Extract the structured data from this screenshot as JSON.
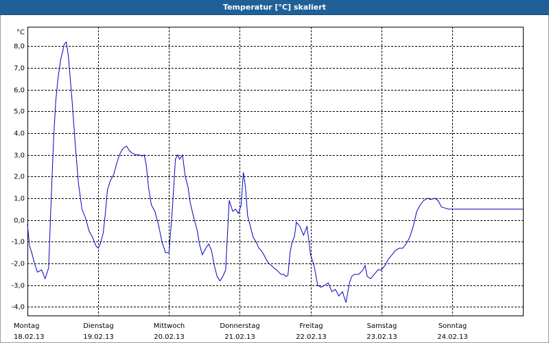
{
  "window": {
    "title": "Temperatur [°C] skaliert"
  },
  "colors": {
    "titlebar": "#1f6196",
    "line": "#0000c0",
    "grid": "#000000"
  },
  "chart_data": {
    "type": "line",
    "title": "Temperatur [°C] skaliert",
    "ylabel": "°C",
    "xlabel": "",
    "ylim": [
      -4.4,
      8.9
    ],
    "xlim": [
      0,
      7
    ],
    "grid": true,
    "yticks": [
      {
        "value": 8,
        "label": "8,0"
      },
      {
        "value": 7,
        "label": "7,0"
      },
      {
        "value": 6,
        "label": "6,0"
      },
      {
        "value": 5,
        "label": "5,0"
      },
      {
        "value": 4,
        "label": "4,0"
      },
      {
        "value": 3,
        "label": "3,0"
      },
      {
        "value": 2,
        "label": "2,0"
      },
      {
        "value": 1,
        "label": "1,0"
      },
      {
        "value": 0,
        "label": "0,0"
      },
      {
        "value": -1,
        "label": "-1,0"
      },
      {
        "value": -2,
        "label": "-2,0"
      },
      {
        "value": -3,
        "label": "-3,0"
      },
      {
        "value": -4,
        "label": "-4,0"
      }
    ],
    "xticks": [
      {
        "day": "Montag",
        "date": "18.02.13"
      },
      {
        "day": "Dienstag",
        "date": "19.02.13"
      },
      {
        "day": "Mittwoch",
        "date": "20.02.13"
      },
      {
        "day": "Donnerstag",
        "date": "21.02.13"
      },
      {
        "day": "Freitag",
        "date": "22.02.13"
      },
      {
        "day": "Samstag",
        "date": "23.02.13"
      },
      {
        "day": "Sonntag",
        "date": "24.02.13"
      }
    ],
    "series": [
      {
        "x": [
          0.0,
          0.03,
          0.06,
          0.1,
          0.14,
          0.2,
          0.25,
          0.3,
          0.33,
          0.37,
          0.4,
          0.43,
          0.47,
          0.5,
          0.52,
          0.55,
          0.58,
          0.63,
          0.68,
          0.72,
          0.77,
          0.82,
          0.87,
          0.92,
          0.97,
          1.0,
          1.03,
          1.07,
          1.1,
          1.13,
          1.17,
          1.22,
          1.26,
          1.3,
          1.33,
          1.37,
          1.4,
          1.44,
          1.47,
          1.5,
          1.53,
          1.58,
          1.62,
          1.65,
          1.68,
          1.71,
          1.75,
          1.8,
          1.85,
          1.9,
          1.95,
          2.0,
          2.05,
          2.09,
          2.12,
          2.15,
          2.19,
          2.23,
          2.27,
          2.3,
          2.35,
          2.4,
          2.43,
          2.47,
          2.52,
          2.56,
          2.6,
          2.64,
          2.68,
          2.72,
          2.76,
          2.8,
          2.85,
          2.9,
          2.94,
          2.98,
          3.02,
          3.05,
          3.08,
          3.11,
          3.15,
          3.19,
          3.23,
          3.27,
          3.3,
          3.34,
          3.37,
          3.41,
          3.45,
          3.48,
          3.52,
          3.55,
          3.58,
          3.62,
          3.65,
          3.68,
          3.71,
          3.74,
          3.77,
          3.8,
          3.85,
          3.9,
          3.95,
          4.0,
          4.05,
          4.1,
          4.15,
          4.2,
          4.25,
          4.3,
          4.35,
          4.4,
          4.45,
          4.5,
          4.55,
          4.58,
          4.62,
          4.65,
          4.68,
          4.71,
          4.74,
          4.77,
          4.8,
          4.85,
          4.9,
          4.95,
          5.0,
          5.05,
          5.1,
          5.15,
          5.2,
          5.25,
          5.3,
          5.35,
          5.4,
          5.45,
          5.5,
          5.55,
          5.6,
          5.65,
          5.7,
          5.75,
          5.8,
          5.85,
          5.9,
          5.95,
          6.0,
          6.05,
          6.1,
          6.15,
          6.2,
          6.25,
          6.3,
          6.35,
          6.4,
          6.45,
          6.48,
          6.52,
          6.56,
          6.6,
          6.64,
          6.68,
          6.72,
          6.76,
          6.8,
          6.85,
          6.9,
          6.95,
          7.0
        ],
        "y": [
          -0.2,
          -1.2,
          -1.5,
          -2.0,
          -2.4,
          -2.3,
          -2.7,
          -2.2,
          0.5,
          3.8,
          5.5,
          6.5,
          7.4,
          7.8,
          8.1,
          8.2,
          7.5,
          5.5,
          3.3,
          1.7,
          0.5,
          0.1,
          -0.5,
          -0.8,
          -1.2,
          -1.3,
          -1.1,
          -0.6,
          0.3,
          1.4,
          1.8,
          2.1,
          2.6,
          3.0,
          3.2,
          3.35,
          3.4,
          3.2,
          3.1,
          3.05,
          3.0,
          3.0,
          2.95,
          3.0,
          2.5,
          1.5,
          0.7,
          0.4,
          -0.2,
          -1.0,
          -1.5,
          -1.5,
          0.6,
          2.8,
          3.0,
          2.8,
          3.0,
          2.0,
          1.5,
          0.8,
          0.1,
          -0.5,
          -1.1,
          -1.6,
          -1.3,
          -1.1,
          -1.4,
          -2.1,
          -2.6,
          -2.8,
          -2.6,
          -2.3,
          0.9,
          0.4,
          0.5,
          0.3,
          0.7,
          2.2,
          1.5,
          0.2,
          -0.3,
          -0.8,
          -1.0,
          -1.3,
          -1.4,
          -1.6,
          -1.8,
          -2.0,
          -2.1,
          -2.2,
          -2.3,
          -2.4,
          -2.5,
          -2.5,
          -2.6,
          -2.55,
          -1.5,
          -1.0,
          -0.8,
          -0.1,
          -0.3,
          -0.7,
          -0.3,
          -1.6,
          -2.1,
          -3.0,
          -3.1,
          -3.0,
          -2.9,
          -3.3,
          -3.2,
          -3.5,
          -3.3,
          -3.8,
          -2.9,
          -2.6,
          -2.5,
          -2.5,
          -2.5,
          -2.4,
          -2.3,
          -2.1,
          -2.6,
          -2.7,
          -2.5,
          -2.3,
          -2.3,
          -2.1,
          -1.8,
          -1.6,
          -1.4,
          -1.3,
          -1.3,
          -1.1,
          -0.8,
          -0.3,
          0.4,
          0.7,
          0.9,
          1.0,
          0.95,
          1.0,
          0.9,
          0.6,
          0.55,
          0.5,
          0.5,
          0.5,
          0.5,
          0.5,
          0.5,
          0.5,
          0.5,
          0.5,
          0.5,
          0.5,
          0.5,
          0.5,
          0.5,
          0.5,
          0.5,
          0.5,
          0.5,
          0.5,
          0.5,
          0.5,
          0.5,
          0.5,
          0.5
        ]
      }
    ]
  }
}
